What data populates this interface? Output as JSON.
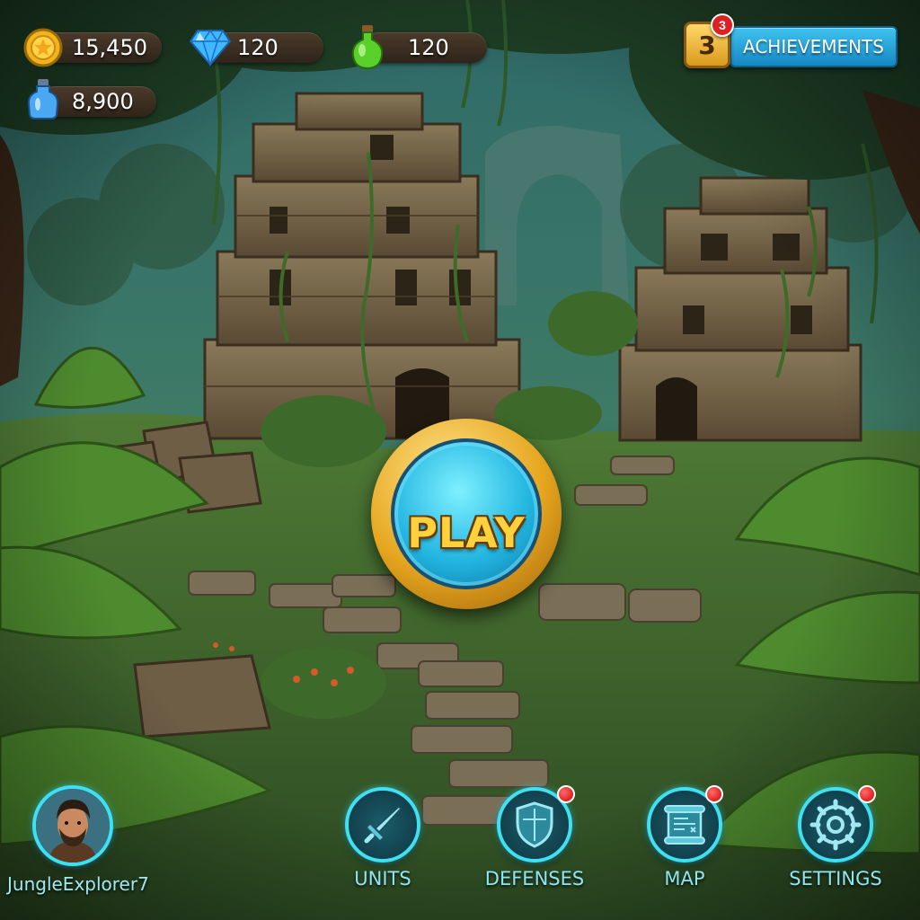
{
  "resources": {
    "gold": {
      "value": "15,450",
      "icon": "gold-coin-icon"
    },
    "gems": {
      "value": "120",
      "icon": "blue-gem-icon"
    },
    "elixir": {
      "value": "120",
      "icon": "green-potion-icon"
    },
    "mana": {
      "value": "8,900",
      "icon": "blue-potion-icon"
    }
  },
  "achievements": {
    "label": "ACHIEVEMENTS",
    "count": "3",
    "badge": "3"
  },
  "play_button": {
    "label": "PLAY"
  },
  "player": {
    "username": "JungleExplorer7"
  },
  "nav": {
    "units": {
      "label": "UNITS",
      "icon": "sword-icon",
      "notification": false
    },
    "defenses": {
      "label": "DEFENSES",
      "icon": "shield-icon",
      "notification": true
    },
    "map": {
      "label": "MAP",
      "icon": "scroll-map-icon",
      "notification": true
    },
    "settings": {
      "label": "SETTINGS",
      "icon": "gear-icon",
      "notification": true
    }
  },
  "colors": {
    "accent_cyan": "#3ee0f2",
    "play_gold": "#ffd23d",
    "notification_red": "#d40000",
    "achievement_blue": "#1687c3"
  }
}
